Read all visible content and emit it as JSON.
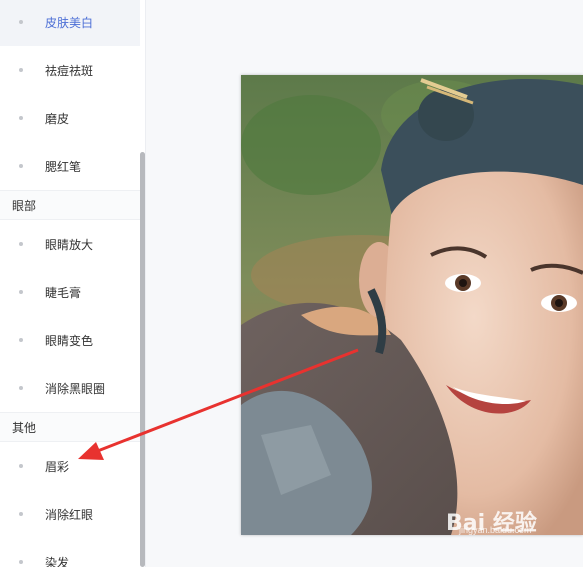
{
  "sidebar": {
    "items_top": [
      {
        "label": "皮肤美白",
        "active": true
      },
      {
        "label": "祛痘祛斑",
        "active": false
      },
      {
        "label": "磨皮",
        "active": false
      },
      {
        "label": "腮红笔",
        "active": false
      }
    ],
    "group_eyes": {
      "title": "眼部",
      "items": [
        {
          "label": "眼睛放大"
        },
        {
          "label": "睫毛膏"
        },
        {
          "label": "眼睛变色"
        },
        {
          "label": "消除黑眼圈"
        }
      ]
    },
    "group_other": {
      "title": "其他",
      "items": [
        {
          "label": "眉彩"
        },
        {
          "label": "消除红眼"
        },
        {
          "label": "染发"
        }
      ]
    }
  },
  "canvas": {
    "watermark_text": "Bai 经验",
    "watermark_url": "jingyan.baidu.com"
  },
  "colors": {
    "active_text": "#4d6fd6",
    "annotation_arrow": "#e8322f"
  }
}
